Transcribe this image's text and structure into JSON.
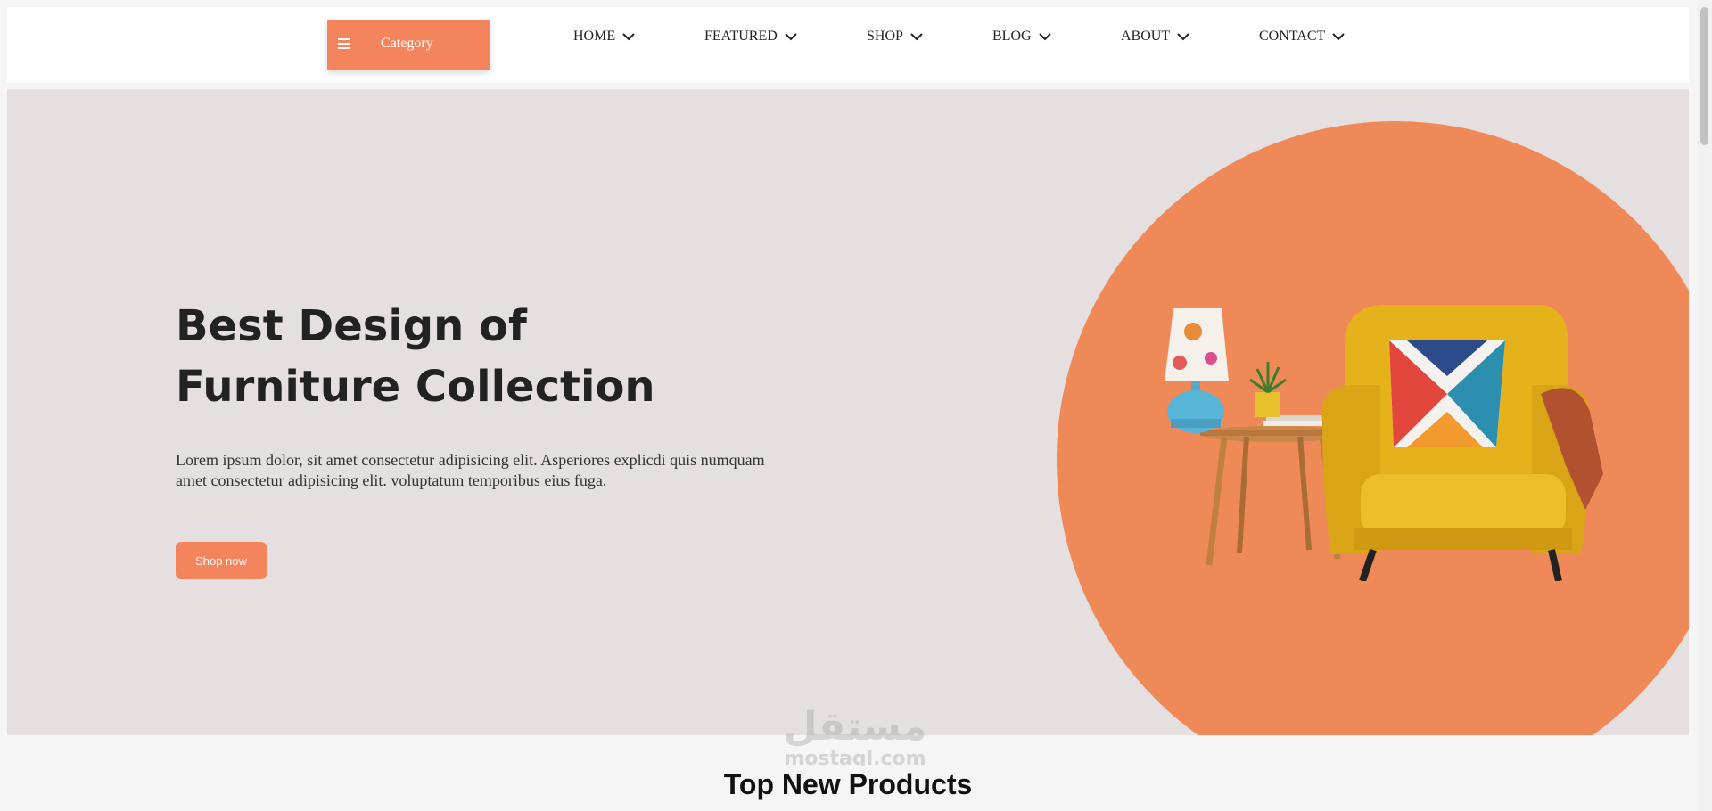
{
  "header": {
    "category_label": "Category",
    "nav": [
      {
        "label": "HOME"
      },
      {
        "label": "FEATURED"
      },
      {
        "label": "SHOP"
      },
      {
        "label": "BLOG"
      },
      {
        "label": "ABOUT"
      },
      {
        "label": "CONTACT"
      }
    ]
  },
  "hero": {
    "title_line1": "Best Design of",
    "title_line2": "Furniture Collection",
    "description_line1": "Lorem ipsum dolor, sit amet consectetur adipisicing elit. Asperiores explicdi quis numquam",
    "description_line2": "amet consectetur adipisicing elit. voluptatum temporibus eius fuga.",
    "button_label": "Shop now"
  },
  "products": {
    "title": "Top New Products"
  },
  "colors": {
    "accent": "#f4845b",
    "hero_bg": "#e5dfdf",
    "circle": "#ef8a58",
    "chair": "#e8b51a"
  },
  "icons": {
    "menu": "hamburger-icon",
    "dropdown": "chevron-down-icon"
  },
  "watermark_text": "مستقل mostaql.com"
}
